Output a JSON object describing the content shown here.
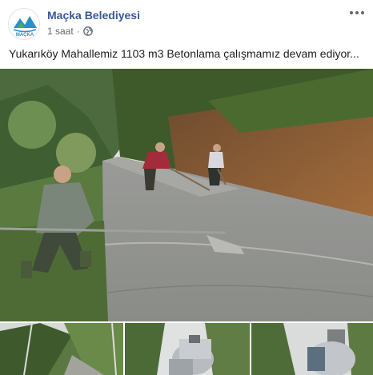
{
  "post": {
    "author": "Maçka Belediyesi",
    "avatar_logo_text": "MAÇKA",
    "timestamp": "1 saat",
    "separator": "·",
    "privacy_icon": "globe-icon",
    "more_icon": "more-options-icon",
    "text": "Yukarıköy Mahallemiz 1103 m3 Betonlama çalışmamız devam ediyor..."
  },
  "photos": {
    "main_alt": "concrete-road-work-photo",
    "thumbnails": [
      "road-forest-photo",
      "concrete-mixer-truck-photo",
      "concrete-mixer-truck-closeup-photo"
    ]
  }
}
